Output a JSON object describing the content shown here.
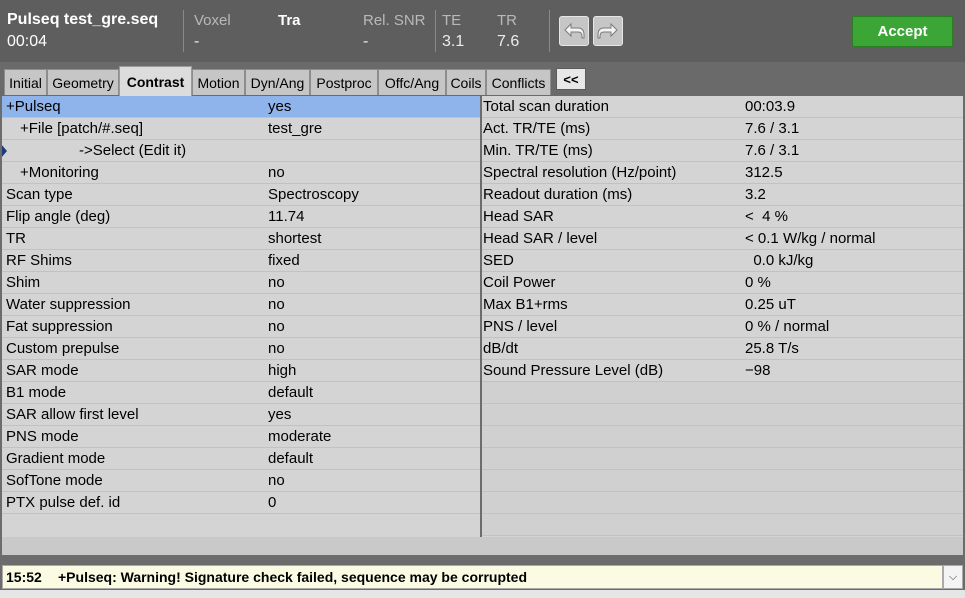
{
  "header": {
    "title": "Pulseq test_gre.seq",
    "time": "00:04",
    "voxel_label": "Voxel",
    "voxel_value": "-",
    "orientation": "Tra",
    "snr_label": "Rel. SNR",
    "snr_value": "-",
    "te_label": "TE",
    "te_value": "3.1",
    "tr_label": "TR",
    "tr_value": "7.6",
    "undo_icon": "undo-arrow-icon",
    "redo_icon": "redo-arrow-icon",
    "accept_label": "Accept",
    "accept_color": "#3ba636"
  },
  "tabs": [
    {
      "label": "Initial"
    },
    {
      "label": "Geometry"
    },
    {
      "label": "Contrast",
      "active": true
    },
    {
      "label": "Motion"
    },
    {
      "label": "Dyn/Ang"
    },
    {
      "label": "Postproc"
    },
    {
      "label": "Offc/Ang"
    },
    {
      "label": "Coils"
    },
    {
      "label": "Conflicts"
    }
  ],
  "collapse_label": "<<",
  "parameters": [
    {
      "name": "+Pulseq",
      "value": "yes"
    },
    {
      "name": "   +File [patch/#.seq]",
      "value": "test_gre"
    },
    {
      "name": "                   ->Select (Edit it)",
      "value": ""
    },
    {
      "name": "   +Monitoring",
      "value": "no"
    },
    {
      "name": "Scan type",
      "value": "Spectroscopy"
    },
    {
      "name": "Flip angle (deg)",
      "value": "11.74"
    },
    {
      "name": "TR",
      "value": "shortest"
    },
    {
      "name": "RF Shims",
      "value": "fixed"
    },
    {
      "name": "Shim",
      "value": "no"
    },
    {
      "name": "Water suppression",
      "value": "no"
    },
    {
      "name": "Fat suppression",
      "value": "no"
    },
    {
      "name": "Custom prepulse",
      "value": "no"
    },
    {
      "name": "SAR mode",
      "value": "high"
    },
    {
      "name": "B1 mode",
      "value": "default"
    },
    {
      "name": "SAR allow first level",
      "value": "yes"
    },
    {
      "name": "PNS mode",
      "value": "moderate"
    },
    {
      "name": "Gradient mode",
      "value": "default"
    },
    {
      "name": "SofTone mode",
      "value": "no"
    },
    {
      "name": "PTX pulse def. id",
      "value": "0"
    }
  ],
  "info": [
    {
      "name": "Total scan duration",
      "value": "00:03.9"
    },
    {
      "name": "Act. TR/TE (ms)",
      "value": "7.6 / 3.1"
    },
    {
      "name": "Min. TR/TE (ms)",
      "value": "7.6 / 3.1"
    },
    {
      "name": "Spectral resolution (Hz/point)",
      "value": "312.5"
    },
    {
      "name": "Readout duration (ms)",
      "value": "3.2"
    },
    {
      "name": "Head SAR",
      "value": "<  4 %"
    },
    {
      "name": "Head SAR / level",
      "value": "< 0.1 W/kg / normal"
    },
    {
      "name": "SED",
      "value": "  0.0 kJ/kg"
    },
    {
      "name": "Coil Power",
      "value": "0 %"
    },
    {
      "name": "Max B1+rms",
      "value": "0.25 uT"
    },
    {
      "name": "PNS / level",
      "value": "0 % / normal"
    },
    {
      "name": "dB/dt",
      "value": "25.8 T/s"
    },
    {
      "name": "Sound Pressure Level (dB)",
      "value": "−98"
    }
  ],
  "status": {
    "time": "15:52",
    "message": "+Pulseq: Warning! Signature check failed, sequence may be corrupted",
    "dropdown_icon": "chevron-down-icon"
  }
}
